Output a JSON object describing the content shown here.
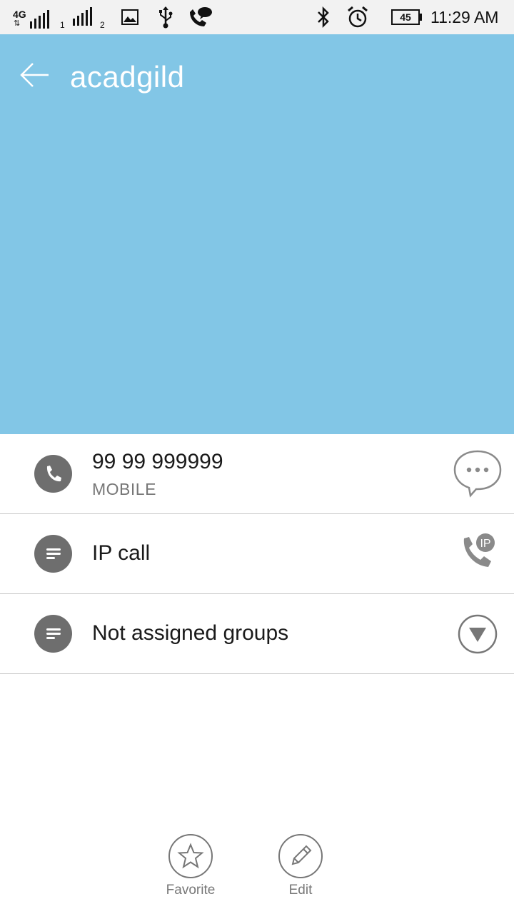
{
  "status_bar": {
    "network": "4G",
    "sim1": "1",
    "sim2": "2",
    "battery": "45",
    "time": "11:29 AM",
    "icons": [
      "signal-icon",
      "image-icon",
      "usb-icon",
      "call-icon",
      "bluetooth-icon",
      "alarm-icon",
      "battery-icon"
    ]
  },
  "header": {
    "title": "acadgild",
    "color": "#82c6e6"
  },
  "rows": [
    {
      "icon": "phone-icon",
      "text": "99 99 999999",
      "sub": "MOBILE",
      "action": "message-icon"
    },
    {
      "icon": "note-icon",
      "text": "IP call",
      "action": "ip-call-icon"
    },
    {
      "icon": "note-icon",
      "text": "Not assigned groups",
      "action": "dropdown-icon"
    }
  ],
  "bottom": {
    "favorite_label": "Favorite",
    "edit_label": "Edit"
  }
}
